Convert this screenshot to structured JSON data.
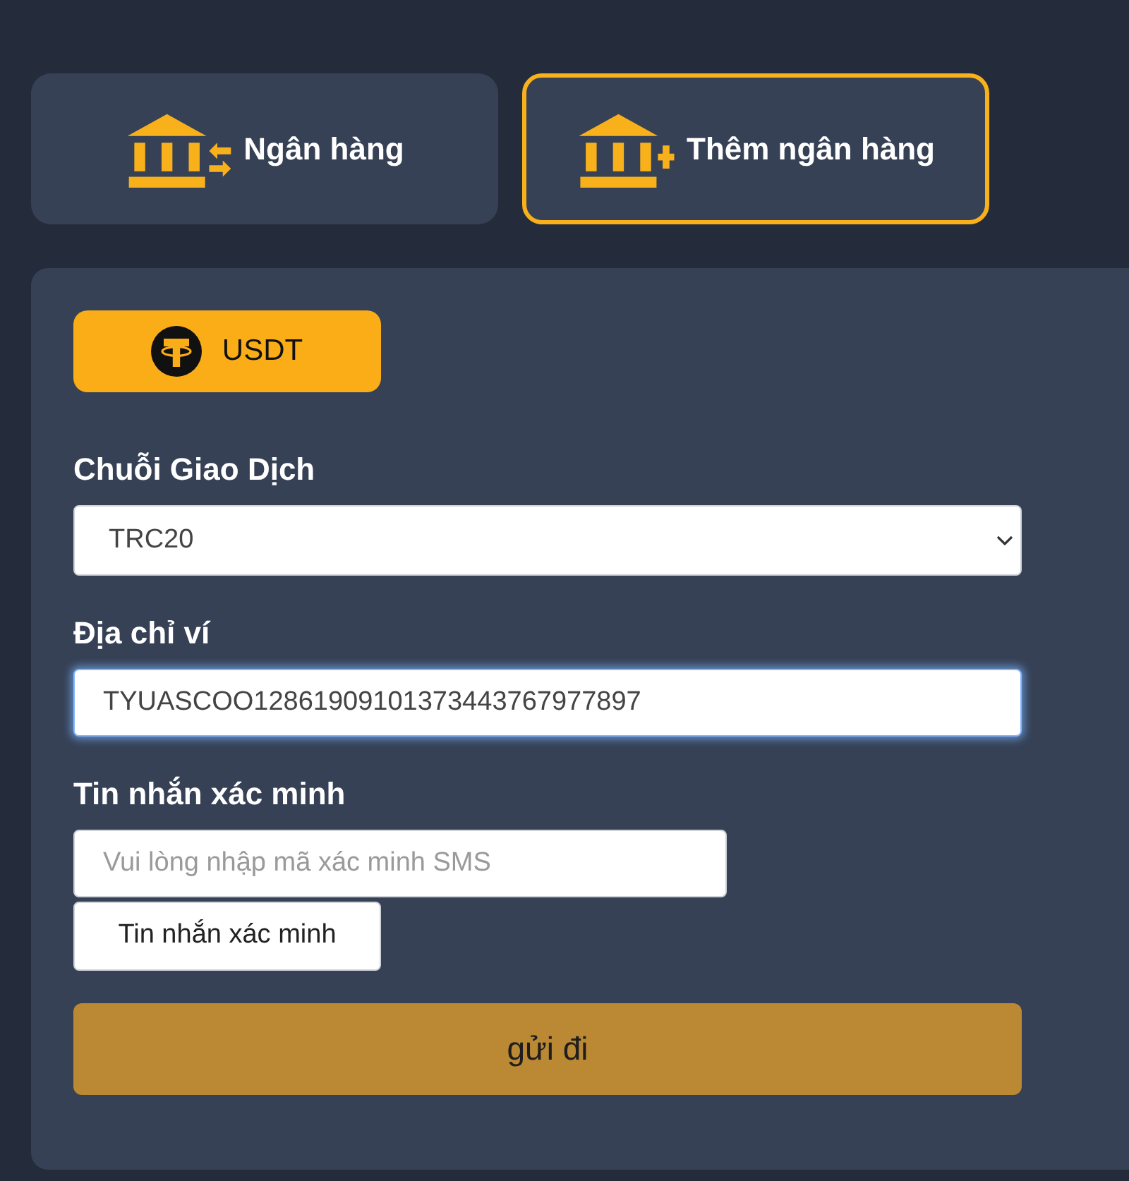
{
  "tabs": [
    {
      "label": "Ngân hàng",
      "kind": "exchange",
      "selected": false
    },
    {
      "label": "Thêm ngân hàng",
      "kind": "add",
      "selected": true
    }
  ],
  "currencies": [
    {
      "label": "USDT",
      "selected": true
    }
  ],
  "form": {
    "fields": [
      {
        "kind": "select",
        "label": "Chuỗi Giao Dịch",
        "value": "TRC20"
      },
      {
        "kind": "text",
        "label": "Địa chỉ ví",
        "value": "TYUASCOO12861909101373443767977897",
        "focused": true
      },
      {
        "kind": "sms",
        "label": "Tin nhắn xác minh",
        "placeholder": "Vui lòng nhập mã xác minh SMS",
        "button": "Tin nhắn xác minh"
      }
    ],
    "submit": "gửi đi"
  }
}
